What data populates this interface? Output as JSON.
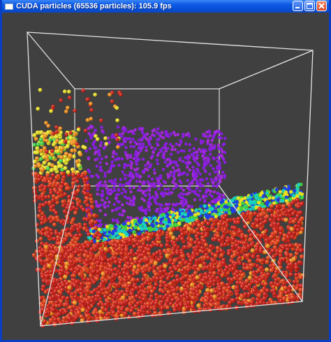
{
  "window": {
    "title": "CUDA particles (65536 particles): 105.9 fps",
    "icon": "app-window-icon",
    "buttons": [
      "minimize-icon",
      "maximize-icon",
      "close-icon"
    ]
  },
  "scene": {
    "background": "#404040",
    "box_color": "#e0e0e0",
    "particle_colors": [
      "#cc1a10",
      "#e03a10",
      "#f08c14",
      "#e8e020",
      "#40d040",
      "#1ad0c0",
      "#2040e0",
      "#8a1ee0",
      "#a32bd8"
    ]
  }
}
